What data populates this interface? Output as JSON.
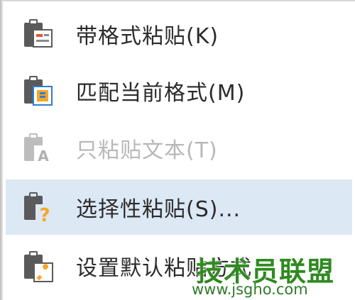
{
  "menu": {
    "items": [
      {
        "label": "带格式粘贴(K)",
        "icon": "paste-keep-format-icon",
        "state": "normal"
      },
      {
        "label": "匹配当前格式(M)",
        "icon": "paste-match-format-icon",
        "state": "normal"
      },
      {
        "label": "只粘贴文本(T)",
        "icon": "paste-text-only-icon",
        "state": "disabled"
      },
      {
        "label": "选择性粘贴(S)...",
        "icon": "paste-special-icon",
        "state": "highlighted"
      },
      {
        "label": "设置默认粘贴方式",
        "icon": "paste-default-settings-icon",
        "state": "normal"
      }
    ]
  },
  "watermark": {
    "title": "技术员联盟",
    "url": "www.jsgho.com"
  },
  "colors": {
    "highlight": "#dde8f5",
    "text": "#2b2b2b",
    "disabled_text": "#b8b8b8",
    "clipboard_body": "#5a5a5a",
    "orange": "#f5a623",
    "blue": "#2a7fd4",
    "watermark_green": "#2f8a1f"
  }
}
